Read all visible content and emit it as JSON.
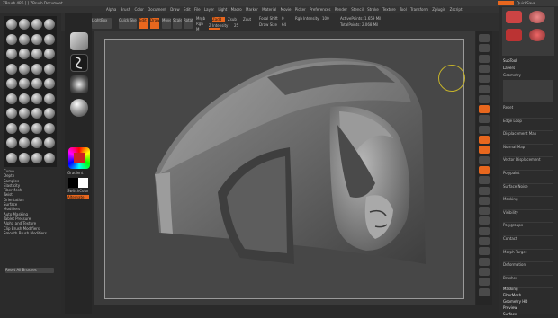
{
  "app": {
    "title": "ZBrush 4R6 [ ] ZBrush Document",
    "title_right": "QuickSave",
    "menus": [
      "Alpha",
      "Brush",
      "Color",
      "Document",
      "Draw",
      "Edit",
      "File",
      "Layer",
      "Light",
      "Macro",
      "Marker",
      "Material",
      "Movie",
      "Picker",
      "Preferences",
      "Render",
      "Stencil",
      "Stroke",
      "Texture",
      "Tool",
      "Transform",
      "Zplugin",
      "Zscript"
    ]
  },
  "toolbar": {
    "projection_master": "Projection Master",
    "lightbox": "LightBox",
    "quick_sketch": "Quick Sketch",
    "edit": "Edit",
    "draw": "Draw",
    "move": "Move",
    "scale": "Scale",
    "rotate": "Rotate",
    "mrgb": "Mrgb",
    "rgb": "Rgb",
    "m": "M",
    "zadd": "Zadd",
    "zsub": "Zsub",
    "zcut": "Zcut",
    "focal_shift_label": "Focal Shift",
    "focal_shift_value": "0",
    "draw_size_label": "Draw Size",
    "draw_size_value": "64",
    "z_intensity_label": "Z Intensity",
    "z_intensity_value": "25",
    "rgb_intensity_label": "Rgb Intensity",
    "rgb_intensity_value": "100",
    "active_points": "ActivePoints: 1.659 Mil",
    "total_points": "TotalPoints: 2.068 Mil"
  },
  "left_panel": {
    "items": [
      "Curve",
      "Depth",
      "Samples",
      "Elasticity",
      "FiberMesh",
      "Twist",
      "Orientation",
      "Surface",
      "Modifiers",
      "Auto Masking",
      "Tablet Pressure",
      "Alpha and Texture",
      "Clip Brush Modifiers",
      "Smooth Brush Modifiers"
    ],
    "footer": "Reset All Brushes"
  },
  "palette": {
    "gradient_label": "Gradient",
    "switch_color_label": "SwitchColor",
    "alternate_label": "Alternate"
  },
  "right_panel": {
    "subtool": "SubTool",
    "layers": "Layers",
    "geometry": "Geometry",
    "sections": [
      "Reset",
      "Edge Loop",
      "Displacement Map",
      "Normal Map",
      "Vector Displacement",
      "Polypaint",
      "Surface Noise",
      "Masking",
      "Visibility",
      "Polygroups",
      "Contact",
      "Morph Target",
      "Deformation",
      "Brushes"
    ],
    "bottom": [
      "Masking",
      "FiberMesh",
      "Geometry HD",
      "Preview",
      "Surface"
    ]
  },
  "colors": {
    "accent": "#e8671e",
    "primary_color": "#cc2222",
    "secondary_color": "#ffffff"
  }
}
